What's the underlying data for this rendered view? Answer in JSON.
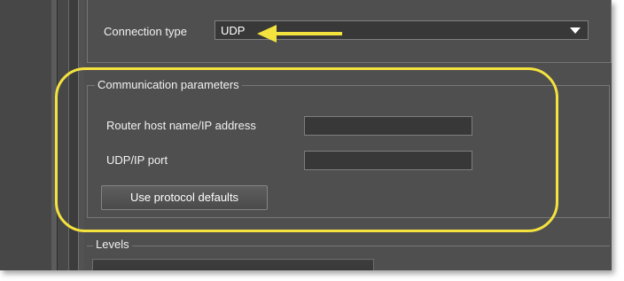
{
  "connection": {
    "label": "Connection type",
    "selected_value": "UDP"
  },
  "communication_parameters": {
    "legend": "Communication parameters",
    "host_label": "Router host name/IP address",
    "host_value": "",
    "port_label": "UDP/IP port",
    "port_value": "",
    "defaults_button_label": "Use protocol defaults"
  },
  "levels": {
    "legend": "Levels"
  },
  "annotation": {
    "highlight_color": "#f4e23e",
    "arrow_color": "#f4e23e"
  },
  "icons": {
    "dropdown": "chevron-down-icon",
    "annotation_arrow": "arrow-left-icon"
  },
  "colors": {
    "panel_background": "#4f4f4f",
    "field_background": "#383838",
    "text": "#f2f2f2"
  }
}
